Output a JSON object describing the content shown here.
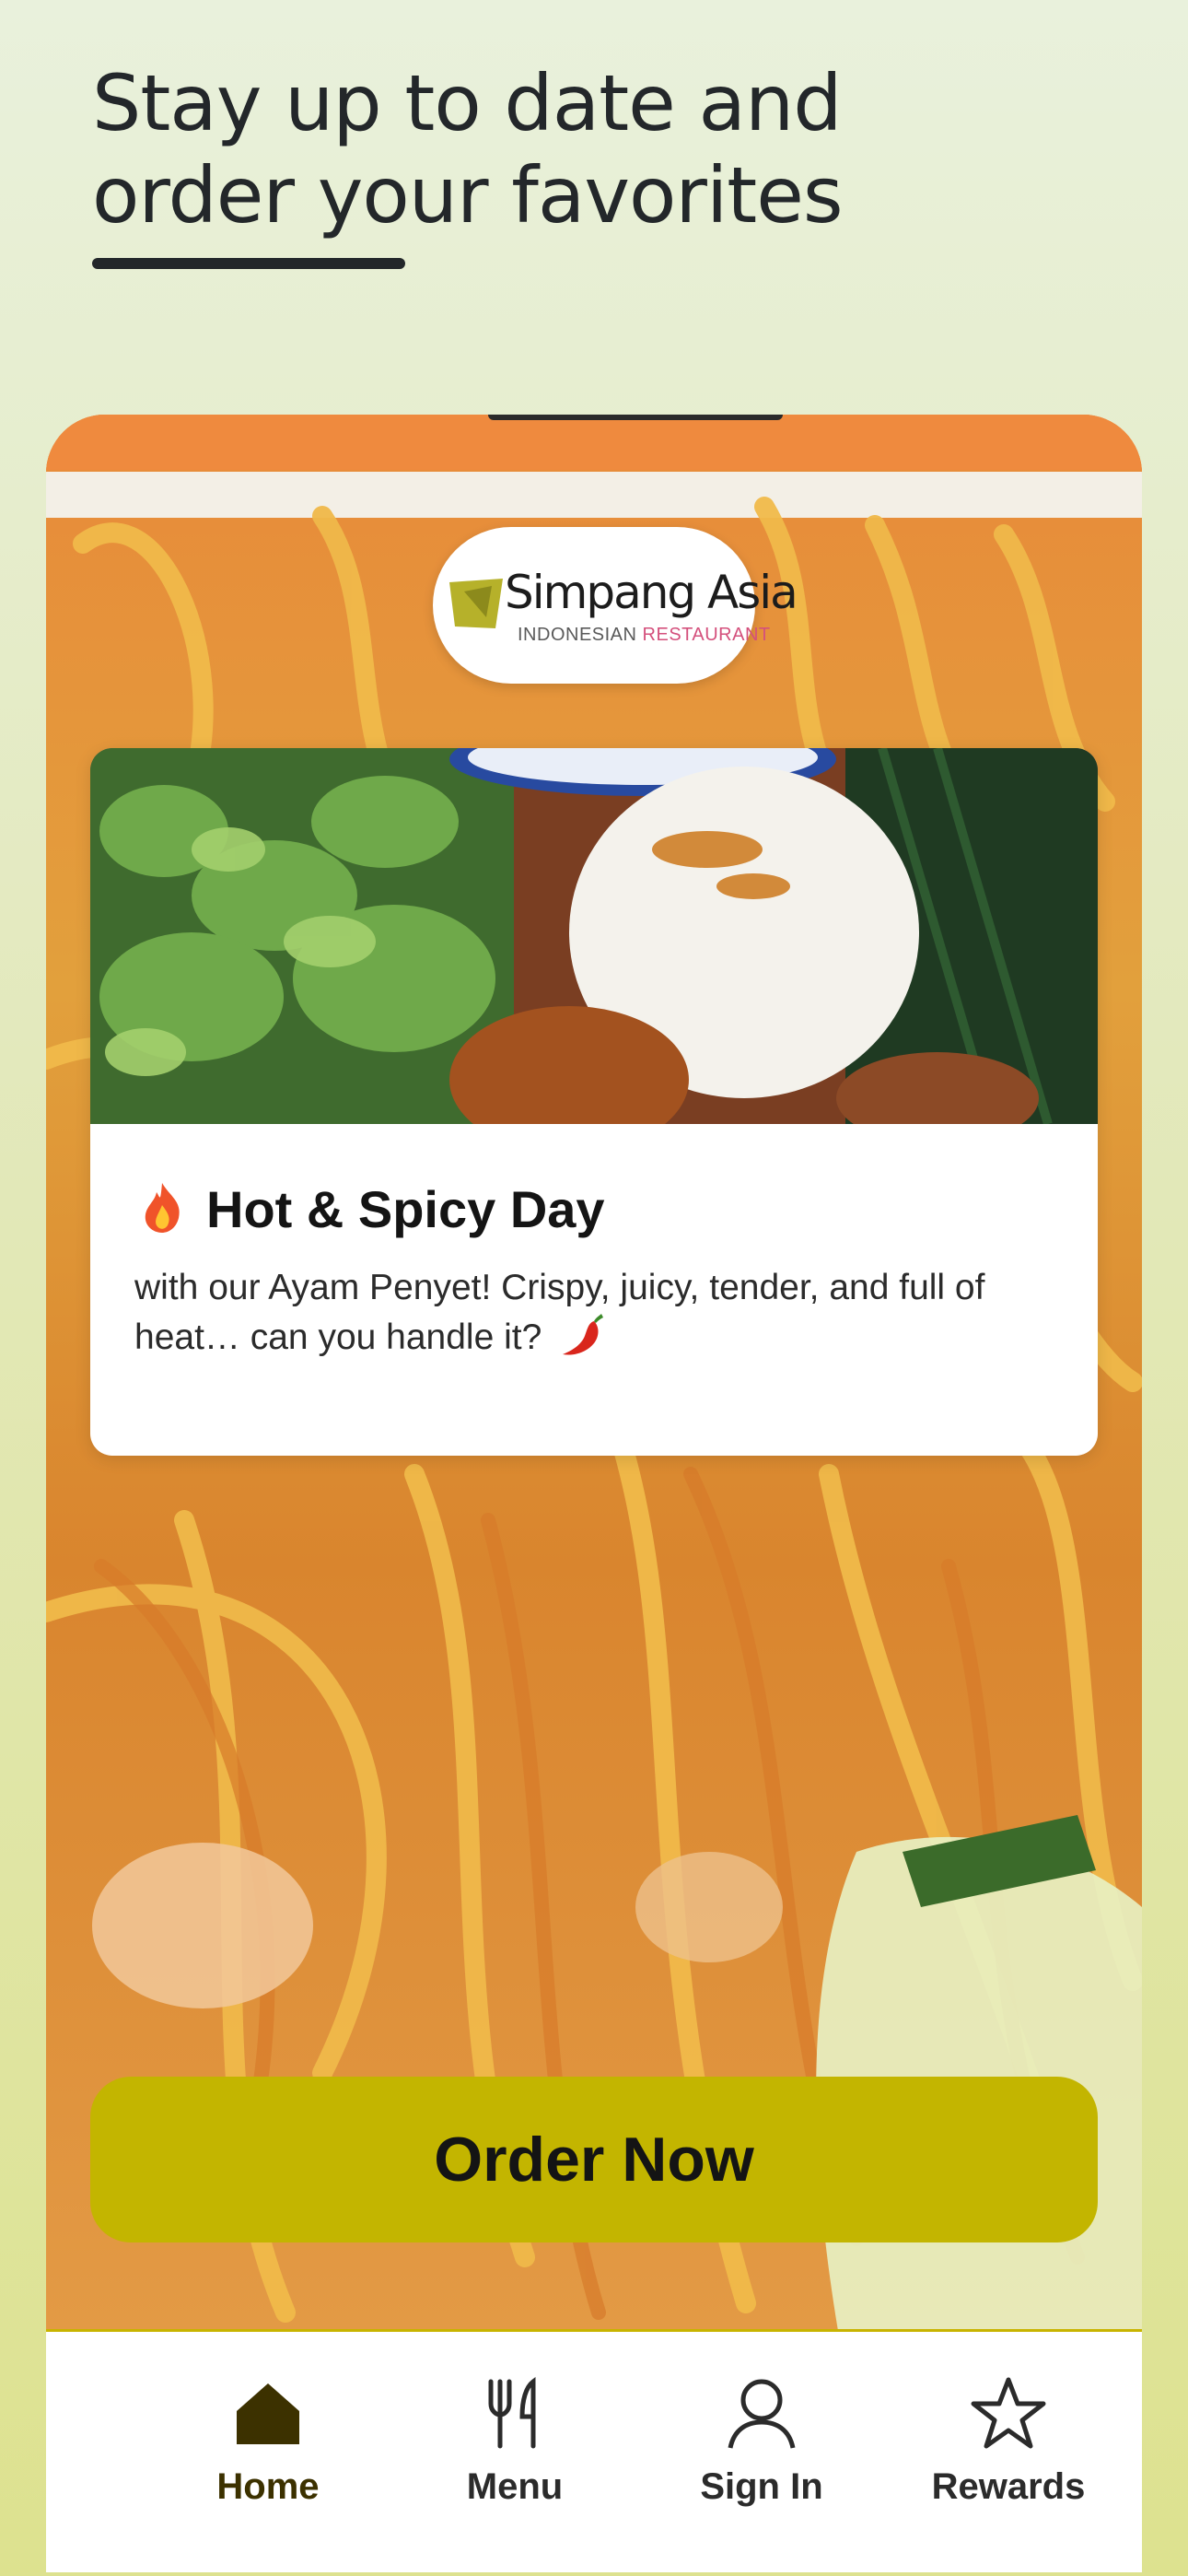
{
  "headline": {
    "line1": "Stay up to date and",
    "line2": "order your favorites"
  },
  "logo": {
    "name": "Simpang Asia",
    "sub_a": "INDONESIAN",
    "sub_b": "RESTAURANT"
  },
  "promo": {
    "title": "Hot & Spicy Day",
    "title_icon": "fire-emoji",
    "text": "with our Ayam Penyet! Crispy, juicy, tender, and full of heat… can you handle it?",
    "text_icon": "chili-pepper-emoji"
  },
  "order_button": {
    "label": "Order Now"
  },
  "tabbar": {
    "items": [
      {
        "label": "Home",
        "icon": "home-icon",
        "active": true
      },
      {
        "label": "Menu",
        "icon": "fork-knife-icon",
        "active": false
      },
      {
        "label": "Sign In",
        "icon": "user-icon",
        "active": false
      },
      {
        "label": "Rewards",
        "icon": "star-icon",
        "active": false
      }
    ]
  },
  "colors": {
    "accent": "#c3b500",
    "active_tab": "#3c3100",
    "text_dark": "#23272a",
    "logo_pink": "#d4507c"
  }
}
